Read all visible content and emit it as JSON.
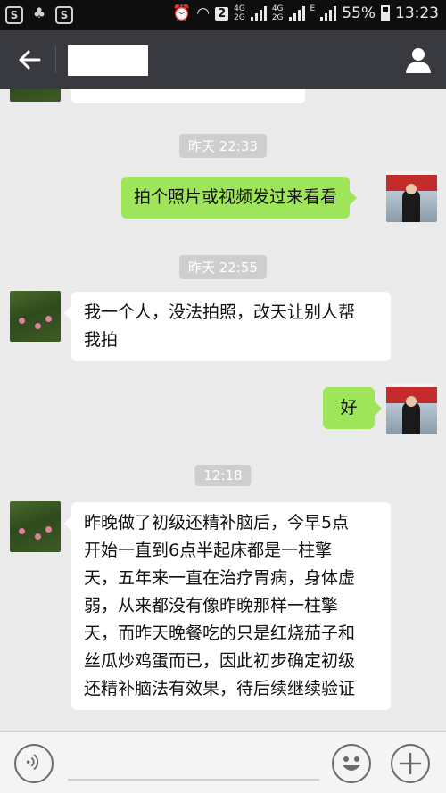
{
  "status_bar": {
    "sim_slot": "2",
    "net_top": "4G",
    "net_bottom": "2G",
    "net2_top": "4G",
    "net2_bottom": "2G",
    "data_type": "E",
    "battery": "55%",
    "time": "13:23"
  },
  "header": {
    "back_icon": "arrow-left-icon",
    "profile_icon": "person-icon"
  },
  "messages": [
    {
      "type": "time",
      "text": "昨天 22:33"
    },
    {
      "type": "sent",
      "lines": [
        "拍个照片或视频发过来看看"
      ]
    },
    {
      "type": "time",
      "text": "昨天 22:55"
    },
    {
      "type": "received",
      "lines": [
        "我一个人，没法拍照，改天让别人帮",
        "我拍"
      ]
    },
    {
      "type": "sent",
      "lines": [
        "好"
      ]
    },
    {
      "type": "time",
      "text": "12:18"
    },
    {
      "type": "received",
      "lines": [
        "昨晚做了初级还精补脑后，今早5点",
        "开始一直到6点半起床都是一柱擎",
        "天，五年来一直在治疗胃病，身体虚",
        "弱，从来都没有像昨晚那样一柱擎",
        "天，而昨天晚餐吃的只是红烧茄子和",
        "丝瓜炒鸡蛋而已，因此初步确定初级",
        "还精补脑法有效果，待后续继续验证"
      ]
    }
  ],
  "colors": {
    "sent_bubble": "#9fe55a",
    "received_bubble": "#ffffff",
    "titlebar": "#383a3f",
    "chat_bg": "#ebebeb"
  }
}
